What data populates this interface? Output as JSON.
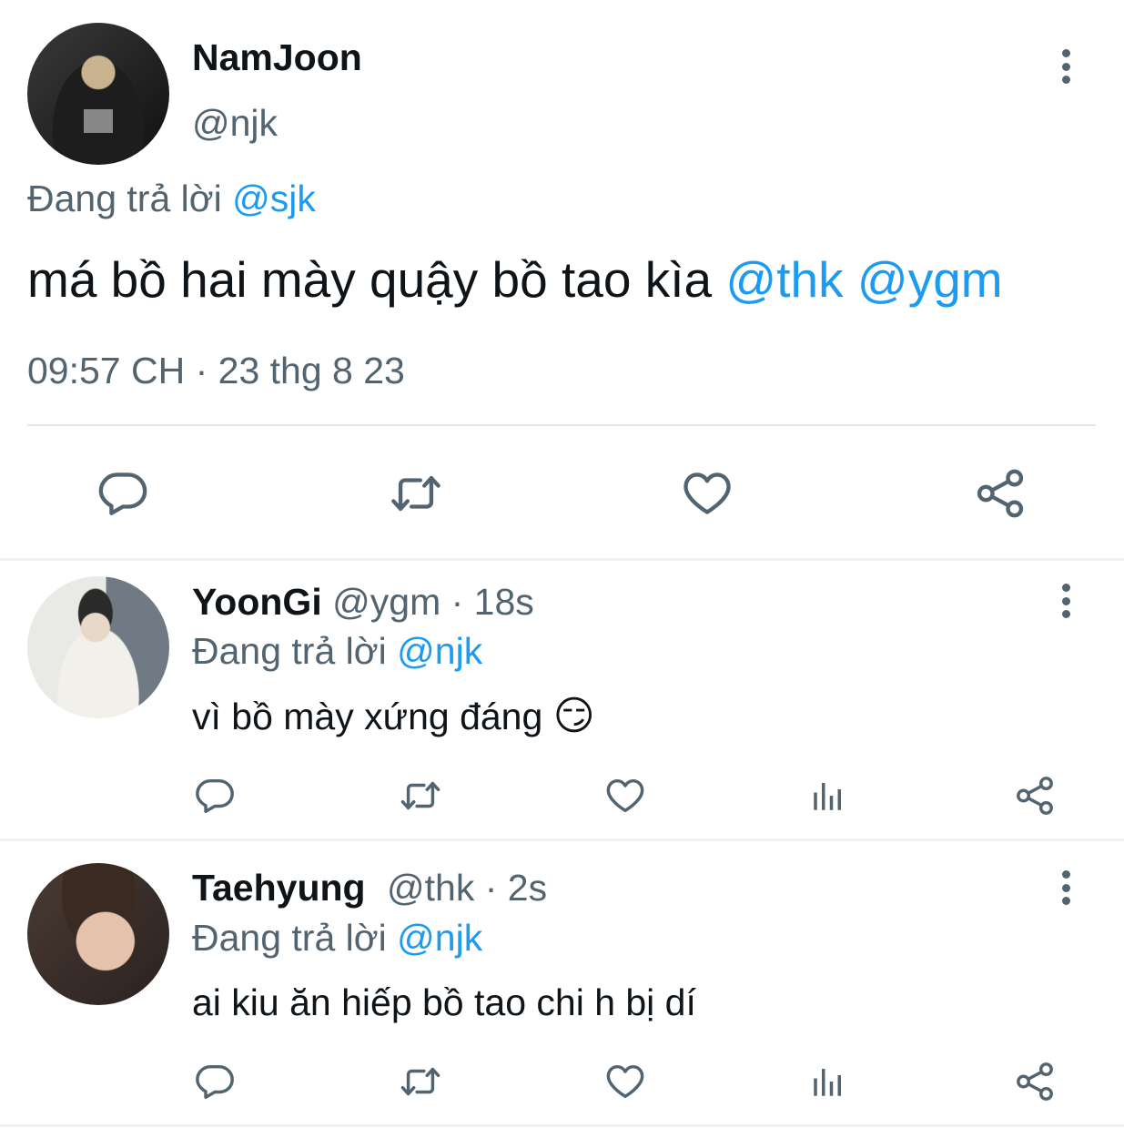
{
  "main_tweet": {
    "name": "NamJoon",
    "handle": "@njk",
    "replying_prefix": "Đang trả lời",
    "replying_to": "@sjk",
    "text": "má bồ hai mày quậy bồ tao kìa",
    "mentions": [
      "@thk",
      "@ygm"
    ],
    "timestamp": "09:57 CH · 23 thg 8 23"
  },
  "replies": [
    {
      "name": "YoonGi",
      "handle": "@ygm",
      "time": "· 18s",
      "replying_prefix": "Đang trả lời",
      "replying_to": "@njk",
      "text": "vì bồ mày xứng đáng",
      "emoji": "😏"
    },
    {
      "name": "Taehyung",
      "handle": "@thk",
      "time": "· 2s",
      "replying_prefix": "Đang trả lời",
      "replying_to": "@njk",
      "text": "ai kiu ăn hiếp bồ tao chi h bị dí"
    }
  ],
  "colors": {
    "accent": "#1d9bf0",
    "secondary_text": "#536471",
    "divider": "#eff3f4"
  },
  "icons": [
    "reply-icon",
    "retweet-icon",
    "like-icon",
    "views-icon",
    "share-icon",
    "more-icon"
  ]
}
